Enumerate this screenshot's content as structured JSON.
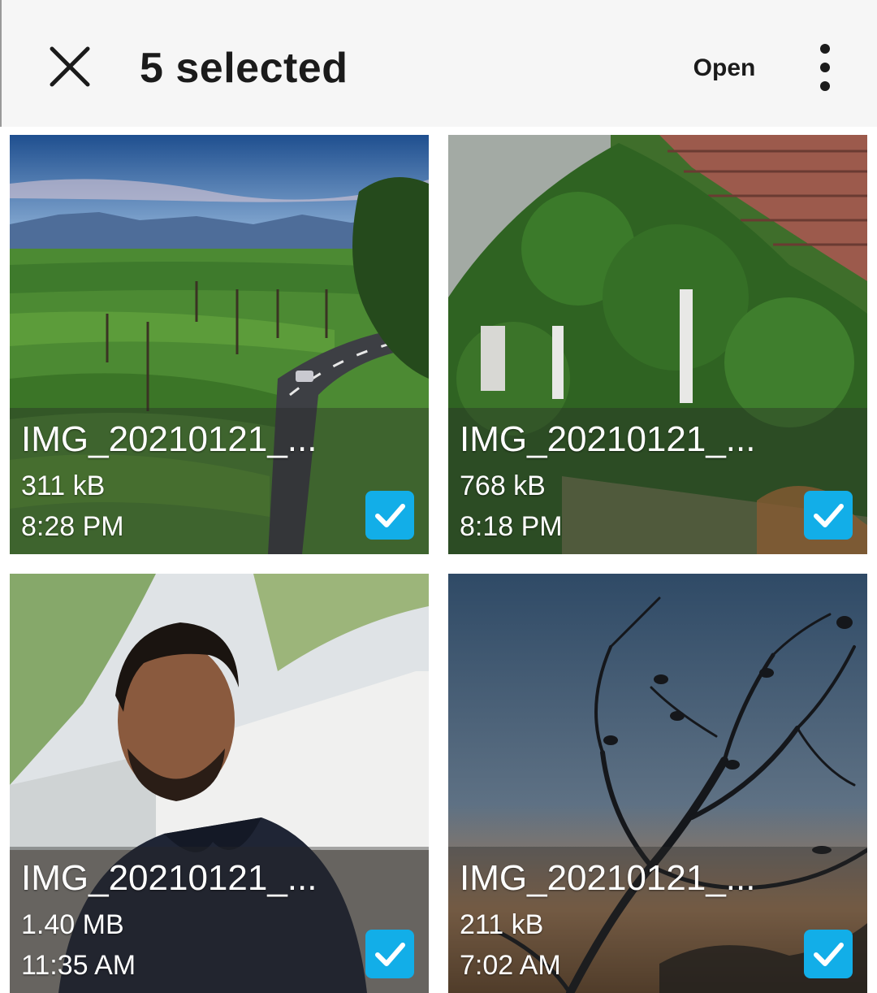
{
  "header": {
    "title": "5 selected",
    "open_label": "Open",
    "close_icon": "close-icon",
    "more_icon": "more-vert-icon"
  },
  "colors": {
    "check_accent": "#12aee8",
    "header_bg": "#f6f6f6"
  },
  "files": [
    {
      "name": "IMG_20210121_...",
      "size": "311 kB",
      "time": "8:28 PM",
      "selected": true
    },
    {
      "name": "IMG_20210121_...",
      "size": "768 kB",
      "time": "8:18 PM",
      "selected": true
    },
    {
      "name": "IMG_20210121_...",
      "size": "1.40 MB",
      "time": "11:35 AM",
      "selected": true
    },
    {
      "name": "IMG_20210121_...",
      "size": "211 kB",
      "time": "7:02 AM",
      "selected": true
    }
  ]
}
